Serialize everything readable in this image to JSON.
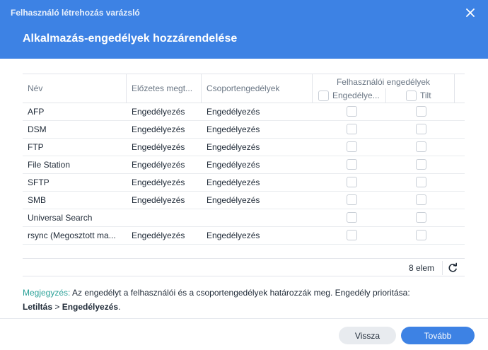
{
  "window": {
    "title": "Felhasználó létrehozás varázsló",
    "page_title": "Alkalmazás-engedélyek hozzárendelése"
  },
  "table": {
    "columns": {
      "name": "Név",
      "preview": "Előzetes megt...",
      "group": "Csoportengedélyek",
      "user_perms": "Felhasználói engedélyek",
      "allow": "Engedélye...",
      "deny": "Tilt"
    },
    "rows": [
      {
        "name": "AFP",
        "preview": "Engedélyezés",
        "group": "Engedélyezés",
        "allow": false,
        "deny": false
      },
      {
        "name": "DSM",
        "preview": "Engedélyezés",
        "group": "Engedélyezés",
        "allow": false,
        "deny": false
      },
      {
        "name": "FTP",
        "preview": "Engedélyezés",
        "group": "Engedélyezés",
        "allow": false,
        "deny": false
      },
      {
        "name": "File Station",
        "preview": "Engedélyezés",
        "group": "Engedélyezés",
        "allow": false,
        "deny": false
      },
      {
        "name": "SFTP",
        "preview": "Engedélyezés",
        "group": "Engedélyezés",
        "allow": false,
        "deny": false
      },
      {
        "name": "SMB",
        "preview": "Engedélyezés",
        "group": "Engedélyezés",
        "allow": false,
        "deny": false
      },
      {
        "name": "Universal Search",
        "preview": "",
        "group": "",
        "allow": false,
        "deny": false
      },
      {
        "name": "rsync (Megosztott ma...",
        "preview": "Engedélyezés",
        "group": "Engedélyezés",
        "allow": false,
        "deny": false
      }
    ],
    "count_label": "8 elem"
  },
  "note": {
    "label": "Megjegyzés:",
    "text": " Az engedélyt a felhasználói és a csoportengedélyek határozzák meg. Engedély prioritása:",
    "deny_word": "Letiltás",
    "separator": " > ",
    "allow_word": "Engedélyezés",
    "end": "."
  },
  "buttons": {
    "back": "Vissza",
    "next": "Tovább"
  },
  "icons": {
    "close": "close-icon",
    "refresh": "refresh-icon"
  },
  "colors": {
    "accent": "#3d82e4",
    "note_label": "#2aa198"
  }
}
